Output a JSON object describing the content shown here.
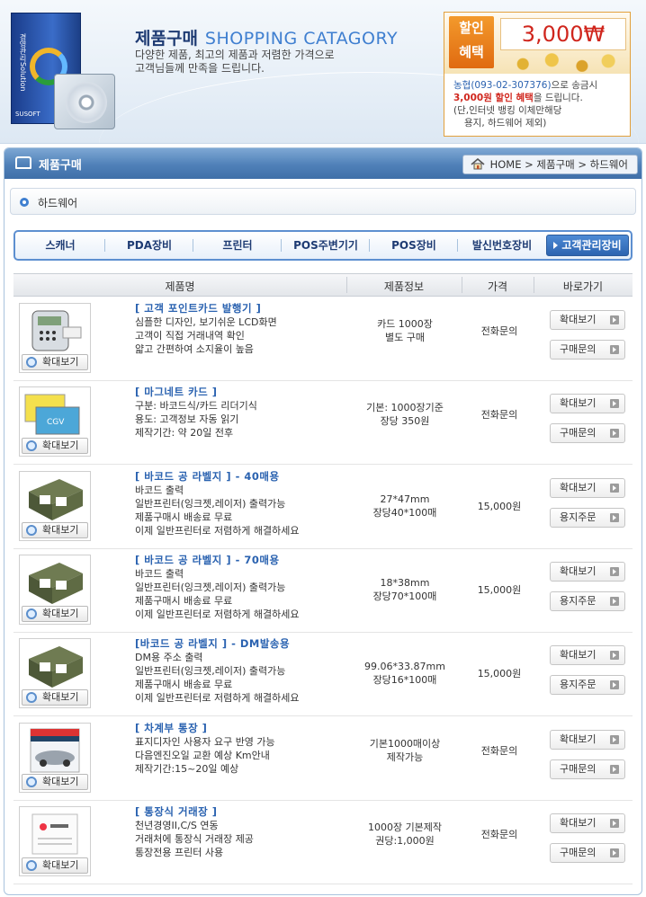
{
  "banner": {
    "title_ko": "제품구매",
    "title_en": "SHOPPING CATAGORY",
    "desc1": "다양한 제품, 최고의 제품과 저렴한 가격으로",
    "desc2": "고객님들께 만족을 드립니다.",
    "box_text": "경영관리Solution",
    "box_brand": "SUSOFT",
    "promo": {
      "badge1": "할인",
      "badge2": "혜택",
      "amount": "3,000₩",
      "bank": "농협(093-02-307376)",
      "line1_rest": "으로 송금시",
      "discount": "3,000원 할인 혜택",
      "line2_rest": "을 드립니다.",
      "line3": "(단,인터넷 뱅킹 이체만해당",
      "line4": "용지, 하드웨어 제외)"
    }
  },
  "titlebar": {
    "title": "제품구매",
    "breadcrumb": "HOME > 제품구매 > 하드웨어"
  },
  "section": {
    "label": "하드웨어"
  },
  "tabs": [
    "스캐너",
    "PDA장비",
    "프린터",
    "POS주변기기",
    "POS장비",
    "발신번호장비",
    "고객관리장비"
  ],
  "table": {
    "headers": [
      "제품명",
      "제품정보",
      "가격",
      "바로가기"
    ],
    "zoom_label": "확대보기",
    "rows": [
      {
        "name": "[ 고객 포인트카드 발행기 ]",
        "desc": [
          "심플한 디자인, 보기쉬운 LCD화면",
          "고객이 직접 거래내역 확인",
          "얇고 간편하여 소지율이 높음"
        ],
        "info": [
          "카드 1000장",
          "별도 구매"
        ],
        "price": "전화문의",
        "btn1": "확대보기",
        "btn2": "구매문의"
      },
      {
        "name": "[ 마그네트 카드 ]",
        "desc": [
          "구분: 바코드식/카드 리더기식",
          "용도: 고객정보 자동 읽기",
          "제작기간: 약 20일 전후"
        ],
        "info": [
          "기본: 1000장기준",
          "장당 350원"
        ],
        "price": "전화문의",
        "btn1": "확대보기",
        "btn2": "구매문의"
      },
      {
        "name": "[ 바코드 공 라벨지 ] - 40매용",
        "desc": [
          "바코드 출력",
          "일반프린터(잉크젯,레이저) 출력가능",
          "제품구매시 배송료 무료",
          "이제 일반프린터로 저렴하게 해결하세요"
        ],
        "info": [
          "27*47mm",
          "장당40*100매"
        ],
        "price": "15,000원",
        "btn1": "확대보기",
        "btn2": "용지주문"
      },
      {
        "name": "[ 바코드 공 라벨지 ] - 70매용",
        "desc": [
          "바코드 출력",
          "일반프린터(잉크젯,레이저) 출력가능",
          "제품구매시 배송료 무료",
          "이제 일반프린터로 저렴하게 해결하세요"
        ],
        "info": [
          "18*38mm",
          "장당70*100매"
        ],
        "price": "15,000원",
        "btn1": "확대보기",
        "btn2": "용지주문"
      },
      {
        "name": "[바코드 공 라벨지 ] - DM발송용",
        "desc": [
          "DM용 주소 출력",
          "일반프린터(잉크젯,레이저) 출력가능",
          "제품구매시 배송료 무료",
          "이제 일반프린터로 저렴하게 해결하세요"
        ],
        "info": [
          "99.06*33.87mm",
          "장당16*100매"
        ],
        "price": "15,000원",
        "btn1": "확대보기",
        "btn2": "용지주문"
      },
      {
        "name": "[ 차계부 통장 ]",
        "desc": [
          "표지디자인 사용자 요구 반영 가능",
          "다음엔진오일 교환 예상 Km안내",
          "제작기간:15~20일 예상"
        ],
        "info": [
          "기본1000매이상",
          "제작가능"
        ],
        "price": "전화문의",
        "btn1": "확대보기",
        "btn2": "구매문의"
      },
      {
        "name": "[ 통장식 거래장 ]",
        "desc": [
          "천년경영II,C/S 연동",
          "거래처에 통장식 거래장 제공",
          "통장전용 프린터 사용"
        ],
        "info": [
          "1000장 기본제작",
          "권당:1,000원"
        ],
        "price": "전화문의",
        "btn1": "확대보기",
        "btn2": "구매문의"
      }
    ]
  },
  "colors": {
    "accent": "#3f7fd0",
    "title_bar": "#4f80b8",
    "name_blue": "#2a62b0",
    "promo_red": "#d0261d"
  }
}
